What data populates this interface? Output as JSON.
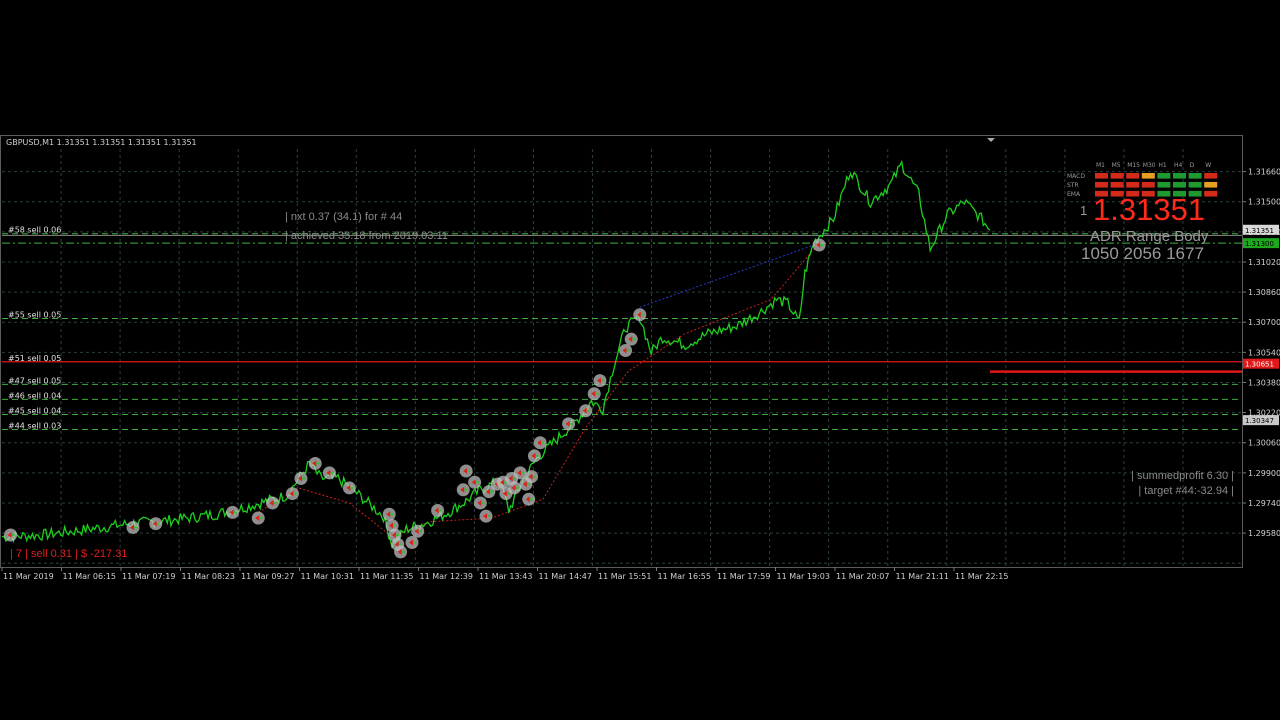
{
  "header": {
    "symbol_line": "GBPUSD,M1  1.31351 1.31351 1.31351 1.31351"
  },
  "colors": {
    "background": "#000000",
    "grid": "#2c3e3e",
    "price_line": "#1ecf1e",
    "sell_level": "#3fae3f",
    "stop_level": "#e01818",
    "current_price": "#ff2a1a",
    "marker_circle": "#bdbdbd",
    "trail_red": "#c82020",
    "trail_blue": "#2a3cc8"
  },
  "chart_data": {
    "type": "line",
    "symbol": "GBPUSD",
    "timeframe": "M1",
    "x_tick_labels": [
      "11 Mar 2019",
      "11 Mar 06:15",
      "11 Mar 07:19",
      "11 Mar 08:23",
      "11 Mar 09:27",
      "11 Mar 10:31",
      "11 Mar 11:35",
      "11 Mar 12:39",
      "11 Mar 13:43",
      "11 Mar 14:47",
      "11 Mar 15:51",
      "11 Mar 16:55",
      "11 Mar 17:59",
      "11 Mar 19:03",
      "11 Mar 20:07",
      "11 Mar 21:11",
      "11 Mar 22:15"
    ],
    "y_tick_labels": [
      "1.31660",
      "1.31500",
      "1.31180",
      "1.31020",
      "1.30860",
      "1.30700",
      "1.30540",
      "1.30380",
      "1.30220",
      "1.30060",
      "1.29900",
      "1.29740",
      "1.29580"
    ],
    "y_ticks": [
      1.3166,
      1.315,
      1.3134,
      1.3118,
      1.3102,
      1.3086,
      1.307,
      1.3054,
      1.3038,
      1.3022,
      1.3006,
      1.299,
      1.2974,
      1.2958
    ],
    "ylim": [
      1.2956,
      1.3178
    ],
    "grid": true,
    "price_series": [
      [
        0,
        1.2972
      ],
      [
        14,
        1.2973
      ],
      [
        30,
        1.2976
      ],
      [
        45,
        1.2979
      ],
      [
        60,
        1.2981
      ],
      [
        75,
        1.2984
      ],
      [
        86,
        1.2988
      ],
      [
        100,
        1.2994
      ],
      [
        108,
        1.3011
      ],
      [
        112,
        1.3003
      ],
      [
        118,
        1.3003
      ],
      [
        124,
        1.2996
      ],
      [
        134,
        1.2983
      ],
      [
        137,
        1.2968
      ],
      [
        142,
        1.2976
      ],
      [
        150,
        1.298
      ],
      [
        158,
        1.2986
      ],
      [
        163,
        1.2991
      ],
      [
        168,
        1.2997
      ],
      [
        175,
        1.3002
      ],
      [
        178,
        1.2986
      ],
      [
        183,
        1.3002
      ],
      [
        188,
        1.3014
      ],
      [
        195,
        1.3024
      ],
      [
        202,
        1.3034
      ],
      [
        207,
        1.3044
      ],
      [
        211,
        1.304
      ],
      [
        215,
        1.3064
      ],
      [
        219,
        1.3083
      ],
      [
        224,
        1.3089
      ],
      [
        228,
        1.307
      ],
      [
        232,
        1.3078
      ],
      [
        240,
        1.3074
      ],
      [
        248,
        1.308
      ],
      [
        258,
        1.3084
      ],
      [
        266,
        1.3091
      ],
      [
        272,
        1.3098
      ],
      [
        276,
        1.3096
      ],
      [
        280,
        1.3086
      ],
      [
        282,
        1.3112
      ],
      [
        285,
        1.3128
      ],
      [
        292,
        1.3141
      ],
      [
        298,
        1.3167
      ],
      [
        305,
        1.315
      ],
      [
        312,
        1.3159
      ],
      [
        316,
        1.317
      ],
      [
        322,
        1.3154
      ],
      [
        326,
        1.3125
      ],
      [
        332,
        1.3143
      ],
      [
        338,
        1.315
      ],
      [
        344,
        1.3141
      ],
      [
        347,
        1.3135
      ]
    ],
    "current_price": "1.31351",
    "level_tags": [
      "1.31351",
      "1.31300",
      "1.30651",
      "1.30347"
    ],
    "sell_levels": [
      {
        "label": "#58 sell 0.06",
        "price": 1.3133
      },
      {
        "label": "#55 sell 0.05",
        "price": 1.3088
      },
      {
        "label": "#51 sell 0.05",
        "price": 1.3065
      },
      {
        "label": "#47 sell 0.05",
        "price": 1.3053
      },
      {
        "label": "#46 sell 0.04",
        "price": 1.3045
      },
      {
        "label": "#45 sell 0.04",
        "price": 1.3037
      },
      {
        "label": "#44 sell 0.03",
        "price": 1.3029
      }
    ],
    "markers": [
      [
        3,
        1.2973
      ],
      [
        46,
        1.2977
      ],
      [
        54,
        1.2979
      ],
      [
        81,
        1.2985
      ],
      [
        90,
        1.2982
      ],
      [
        95,
        1.299
      ],
      [
        102,
        1.2995
      ],
      [
        105,
        1.3003
      ],
      [
        110,
        1.3011
      ],
      [
        115,
        1.3006
      ],
      [
        122,
        1.2998
      ],
      [
        136,
        1.2984
      ],
      [
        137,
        1.2978
      ],
      [
        138,
        1.2973
      ],
      [
        139,
        1.2968
      ],
      [
        140,
        1.2964
      ],
      [
        144,
        1.2969
      ],
      [
        146,
        1.2975
      ],
      [
        153,
        1.2986
      ],
      [
        162,
        1.2997
      ],
      [
        163,
        1.3007
      ],
      [
        166,
        1.3001
      ],
      [
        168,
        1.299
      ],
      [
        170,
        1.2983
      ],
      [
        171,
        1.2996
      ],
      [
        174,
        1.3
      ],
      [
        176,
        1.3001
      ],
      [
        177,
        1.2995
      ],
      [
        179,
        1.3003
      ],
      [
        180,
        1.2998
      ],
      [
        182,
        1.3006
      ],
      [
        184,
        1.3
      ],
      [
        185,
        1.2992
      ],
      [
        186,
        1.3004
      ],
      [
        187,
        1.3015
      ],
      [
        189,
        1.3022
      ],
      [
        199,
        1.3032
      ],
      [
        205,
        1.3039
      ],
      [
        208,
        1.3048
      ],
      [
        210,
        1.3055
      ],
      [
        219,
        1.3071
      ],
      [
        221,
        1.3077
      ],
      [
        224,
        1.309
      ],
      [
        287,
        1.3127
      ]
    ]
  },
  "overlays": {
    "next_text": "| nxt 0.37 (34.1) for # 44",
    "achieved_text": "| achieved 33.18 from 2019.03.11",
    "position_text": "| 7 | sell 0.31 | $ -217.31",
    "summed_text": "| summedprofit 6.30 |",
    "target_text": "| target #44:-32.94 |",
    "price_prefix": "1",
    "big_price": "1.31351",
    "adr_labels": "ADR   Range   Body",
    "adr_values": "1050   2056  1677",
    "indicator_panel": {
      "row_labels": [
        "MACD",
        "STR",
        "EMA"
      ],
      "timeframes": [
        "M1",
        "M5",
        "M15",
        "M30",
        "H1",
        "H4",
        "D",
        "W"
      ],
      "cells": [
        [
          "red",
          "red",
          "red",
          "orange",
          "green",
          "green",
          "green",
          "red"
        ],
        [
          "red",
          "red",
          "red",
          "red",
          "green",
          "green",
          "green",
          "orange"
        ],
        [
          "red",
          "red",
          "red",
          "red",
          "green",
          "green",
          "green",
          "red"
        ]
      ]
    }
  }
}
